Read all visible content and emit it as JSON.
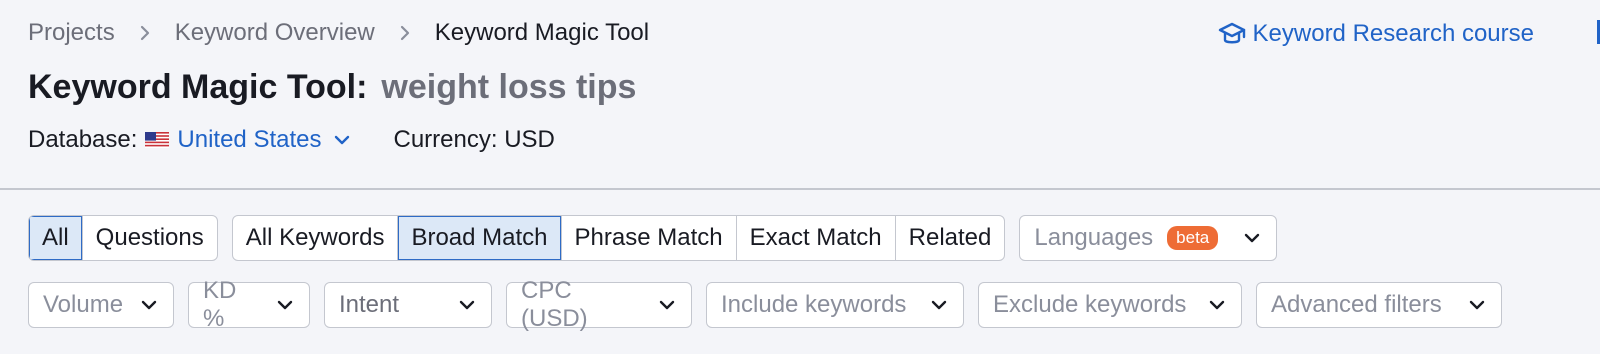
{
  "breadcrumb": {
    "items": [
      "Projects",
      "Keyword Overview"
    ],
    "current": "Keyword Magic Tool"
  },
  "course_link": {
    "label": "Keyword Research course",
    "icon": "graduation-cap-icon"
  },
  "title": {
    "tool": "Keyword Magic Tool:",
    "query": "weight loss tips"
  },
  "database": {
    "label": "Database:",
    "value": "United States",
    "flag_icon": "us-flag-icon"
  },
  "currency": {
    "text": "Currency: USD"
  },
  "query_type": {
    "options": [
      "All",
      "Questions"
    ],
    "selected": "All"
  },
  "match_type": {
    "options": [
      "All Keywords",
      "Broad Match",
      "Phrase Match",
      "Exact Match",
      "Related"
    ],
    "selected": "Broad Match"
  },
  "languages": {
    "label": "Languages",
    "badge": "beta"
  },
  "filters": [
    {
      "label": "Volume"
    },
    {
      "label": "KD %"
    },
    {
      "label": "Intent"
    },
    {
      "label": "CPC (USD)"
    },
    {
      "label": "Include keywords"
    },
    {
      "label": "Exclude keywords"
    },
    {
      "label": "Advanced filters"
    }
  ],
  "colors": {
    "accent": "#2063c7",
    "active_bg": "#dce8f7",
    "beta_badge": "#ee6c35",
    "background": "#f4f5f9"
  }
}
